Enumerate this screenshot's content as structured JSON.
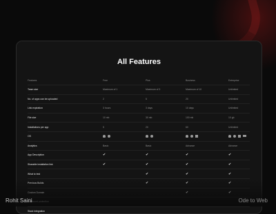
{
  "title": "All Features",
  "columns": [
    "Features",
    "Free",
    "Plus",
    "Business",
    "Enterprise"
  ],
  "rows": [
    {
      "feature": "Team size",
      "values": [
        "Maximum of 1",
        "Maximum of 3",
        "Maximum of 10",
        "Unlimited"
      ]
    },
    {
      "feature": "No. of apps can be uploaded",
      "values": [
        "2",
        "5",
        "20",
        "Unlimited"
      ]
    },
    {
      "feature": "Link expiration",
      "values": [
        "3 hours",
        "3 days",
        "10 days",
        "Unlimited"
      ]
    },
    {
      "feature": "File size",
      "values": [
        "10 mb",
        "30 mb",
        "100 mb",
        "10 gb"
      ]
    },
    {
      "feature": "Installations per app",
      "values": [
        "5",
        "20",
        "60",
        "Unlimited"
      ]
    },
    {
      "feature": "OS",
      "values": [
        "",
        "",
        "",
        ""
      ]
    },
    {
      "feature": "Analytics",
      "values": [
        "Basic",
        "Basic",
        "Advance",
        "Advance"
      ]
    },
    {
      "feature": "App Description",
      "values": [
        "✔",
        "✔",
        "✔",
        "✔"
      ]
    },
    {
      "feature": "Sharable installation link",
      "values": [
        "✔",
        "✔",
        "✔",
        "✔"
      ]
    },
    {
      "feature": "What to test",
      "values": [
        "",
        "✔",
        "✔",
        "✔"
      ]
    },
    {
      "feature": "Previous Builds",
      "values": [
        "",
        "✔",
        "✔",
        "✔"
      ]
    },
    {
      "feature": "Custom Domain",
      "values": [
        "",
        "",
        "✔",
        "✔"
      ]
    },
    {
      "feature": "Password protection",
      "values": [
        "",
        "",
        "",
        ""
      ]
    },
    {
      "feature": "Slack integration",
      "values": [
        "",
        "",
        "",
        ""
      ]
    }
  ],
  "os_icons": {
    "free": [
      "android-icon",
      "apple-icon"
    ],
    "plus": [
      "android-icon",
      "apple-icon"
    ],
    "business": [
      "android-icon",
      "apple-icon",
      "windows-icon"
    ],
    "enterprise": [
      "android-icon",
      "apple-icon",
      "windows-icon",
      "web-icon"
    ]
  },
  "footer": {
    "author": "Rohit Saini",
    "brand": "Ode to Web"
  },
  "colors": {
    "background": "#0a0a0a",
    "panel": "#141414",
    "accent": "#8c1e1e"
  }
}
